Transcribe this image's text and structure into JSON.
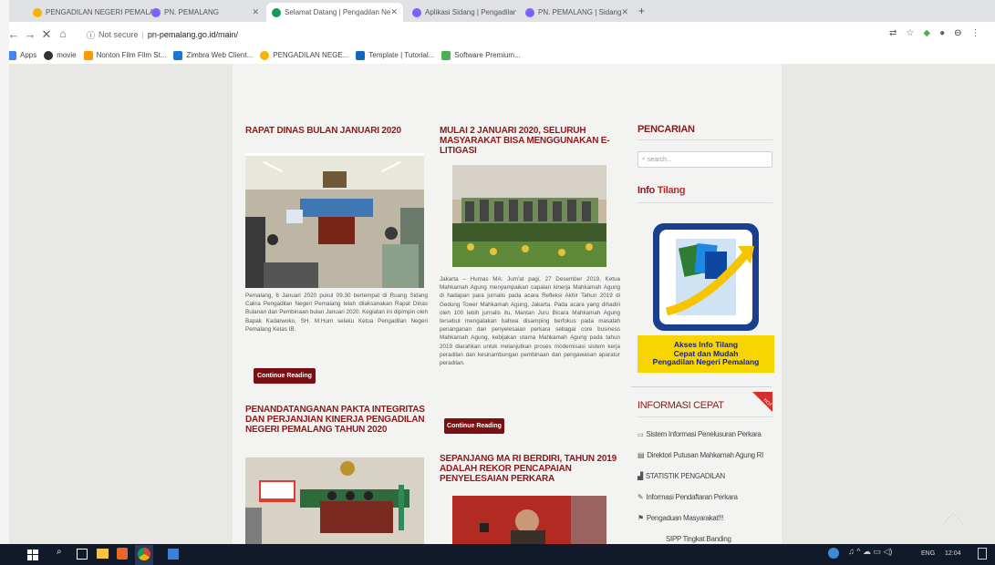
{
  "browser": {
    "tabs": [
      {
        "label": "PENGADILAN NEGERI PEMALA",
        "color": "#f4b400",
        "active": false
      },
      {
        "label": "PN. PEMALANG",
        "color": "#7b61ff",
        "active": false
      },
      {
        "label": "Selamat Datang | Pengadilan Ne",
        "color": "#0f9d58",
        "active": true
      },
      {
        "label": "Aplikasi Sidang | Pengadilan Ne",
        "color": "#7b61ff",
        "active": false
      },
      {
        "label": "PN. PEMALANG | Sidang",
        "color": "#7b61ff",
        "active": false
      }
    ],
    "new_tab": "+",
    "address": {
      "security": "Not secure",
      "separator": "|",
      "url": "pn-pemalang.go.id/main/"
    },
    "bookmarks": [
      {
        "label": "Apps",
        "color": "#4285f4"
      },
      {
        "label": "movie",
        "color": "#333333"
      },
      {
        "label": "Nonton Film Film St...",
        "color": "#ff9800"
      },
      {
        "label": "Zimbra Web Client...",
        "color": "#1976d2"
      },
      {
        "label": "PENGADILAN NEGE...",
        "color": "#f4b400"
      },
      {
        "label": "Template | Tutorial...",
        "color": "#1565c0"
      },
      {
        "label": "Software Premium...",
        "color": "#4caf50"
      }
    ]
  },
  "posts": [
    {
      "title": "RAPAT DINAS BULAN JANUARI 2020",
      "body": "Pemalang, 6 Januari 2020 pukul 09.30 bertempat di Ruang Sidang Cakra Pengadilan Negeri Pemalang telah dilaksanakan Rapat Dinas Bulanan dan Pembinaan bulan Januari 2020. Kegiatan ini dipimpin oleh Bapak Kadarwoko, SH. M.Hum selaku Ketua Pengadilan Negeri Pemalang Kelas IB.",
      "button": "Continue Reading"
    },
    {
      "title": "MULAI 2 JANUARI 2020, SELURUH MASYARAKAT BISA MENGGUNAKAN E-LITIGASI",
      "body": "Jakarta – Humas MA: Jum'at pagi, 27 Desember 2019, Ketua Mahkamah Agung menyampaikan capaian kinerja Mahkamah Agung di hadapan para jurnalis pada acara Refleksi Akhir Tahun 2019 di Gedung Tower Mahkamah Agung, Jakarta. Pada acara yang dihadiri oleh 100 lebih jurnalis itu, Mantan Juru Bicara Mahkamah Agung tersebut mengatakan bahwa disamping berfokus pada masalah penanganan dan penyelesaian perkara sebagai core business Mahkamah Agung, kebijakan utama Mahkamah Agung pada tahun 2019 diarahkan untuk melanjutkan proses modernisasi sistem kerja peradilan dan kesinambungan pembinaan dan pengawasan aparatur peradilan.",
      "button": "Continue Reading"
    },
    {
      "title": "PENANDATANGANAN PAKTA INTEGRITAS DAN PERJANJIAN KINERJA PENGADILAN NEGERI PEMALANG TAHUN 2020"
    },
    {
      "title": "SEPANJANG MA RI BERDIRI, TAHUN 2019 ADALAH REKOR PENCAPAIAN PENYELESAIAN PERKARA"
    }
  ],
  "sidebar": {
    "search_heading": "PENCARIAN",
    "search_placeholder": "search...",
    "info_heading_a": "Info",
    "info_heading_b": "Tilang",
    "tilang_banner": [
      "Akses Info Tilang",
      "Cepat dan Mudah",
      "Pengadilan Negeri Pemalang"
    ],
    "quick_heading": "INFORMASI CEPAT",
    "hot_badge": "HOT",
    "quick_items": [
      {
        "label": "Sistem Informasi Penelusuran Perkara",
        "icon": "sipp-icon"
      },
      {
        "label": "Direktori Putusan Mahkamah Agung RI",
        "icon": "directory-icon"
      },
      {
        "label": "STATISTIK PENGADILAN",
        "icon": "chart-icon"
      },
      {
        "label": "Informasi Pendaftaran Perkara",
        "icon": "info-icon"
      },
      {
        "label": "Pengaduan Masyarakat!!!",
        "icon": "complaint-icon"
      },
      {
        "label": "SIPP Tingkat Banding",
        "icon": "appeal-icon"
      }
    ]
  },
  "taskbar": {
    "lang": "ENG",
    "time": "12:04"
  }
}
